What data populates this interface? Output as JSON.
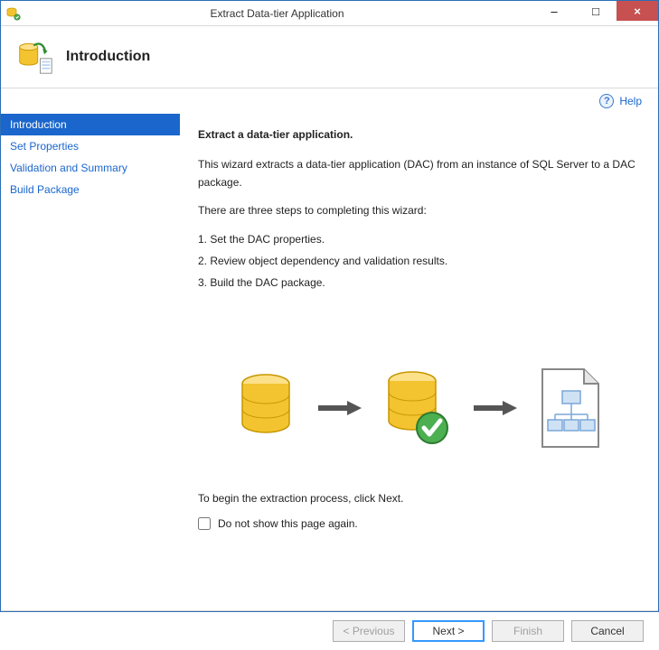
{
  "window": {
    "title": "Extract Data-tier Application",
    "minimize_label": "–",
    "maximize_label": "□",
    "close_label": "×"
  },
  "header": {
    "title": "Introduction"
  },
  "help": {
    "label": "Help"
  },
  "sidebar": {
    "items": [
      {
        "label": "Introduction",
        "active": true
      },
      {
        "label": "Set Properties",
        "active": false
      },
      {
        "label": "Validation and Summary",
        "active": false
      },
      {
        "label": "Build Package",
        "active": false
      }
    ]
  },
  "content": {
    "heading": "Extract a data-tier application.",
    "intro": "This wizard extracts a data-tier application (DAC) from an instance of SQL Server to a DAC package.",
    "steps_intro": "There are three steps to completing this wizard:",
    "steps": [
      "1. Set the DAC properties.",
      "2. Review object dependency and validation results.",
      "3. Build the DAC package."
    ],
    "begin_text": "To begin the extraction process, click Next.",
    "checkbox_label": "Do not show this page again."
  },
  "footer": {
    "previous": "< Previous",
    "next": "Next >",
    "finish": "Finish",
    "cancel": "Cancel"
  }
}
